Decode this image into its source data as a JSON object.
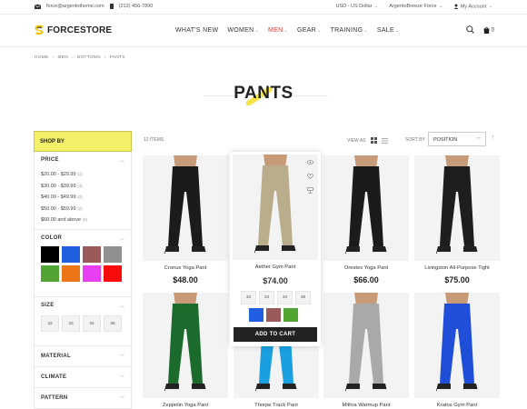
{
  "topbar": {
    "email": "force@argentotheme.com",
    "phone": "(212) 456-7890",
    "currency": "USD - US Dollar",
    "store": "ArgentoBreeze Force",
    "account": "My Account"
  },
  "header": {
    "logo": "FORCESTORE",
    "nav": [
      {
        "label": "WHAT'S NEW"
      },
      {
        "label": "WOMEN"
      },
      {
        "label": "MEN"
      },
      {
        "label": "GEAR"
      },
      {
        "label": "TRAINING"
      },
      {
        "label": "SALE"
      }
    ],
    "cart_count": "0"
  },
  "breadcrumb": [
    "HOME",
    "MEN",
    "BOTTOMS",
    "PANTS"
  ],
  "page_title": "PANTS",
  "sidebar": {
    "shop_by": "SHOP BY",
    "price": {
      "label": "PRICE",
      "items": [
        {
          "range": "$20.00 - $29.99",
          "count": "(2)"
        },
        {
          "range": "$30.00 - $39.99",
          "count": "(3)"
        },
        {
          "range": "$40.00 - $49.99",
          "count": "(2)"
        },
        {
          "range": "$50.00 - $59.99",
          "count": "(2)"
        },
        {
          "range": "$60.00 and above",
          "count": "(2)"
        }
      ]
    },
    "color": {
      "label": "COLOR",
      "swatches": [
        "#000000",
        "#1f5fe0",
        "#9b5a5a",
        "#909090",
        "#52a533",
        "#ec7615",
        "#e93ff2",
        "#fa0b0b"
      ]
    },
    "size": {
      "label": "SIZE",
      "values": [
        "32",
        "33",
        "34",
        "36"
      ]
    },
    "material": "MATERIAL",
    "climate": "CLIMATE",
    "pattern": "PATTERN"
  },
  "toolbar": {
    "items_count": "12 ITEMS",
    "view_as": "VIEW AS",
    "sort_by": "SORT BY",
    "sort_value": "POSITION"
  },
  "products": [
    {
      "name": "Cronus Yoga Pant",
      "price": "$48.00",
      "color": "#1b1b1b"
    },
    {
      "name": "Aether Gym Pant",
      "price": "$74.00",
      "color": "#b9ad8c"
    },
    {
      "name": "Orestes Yoga Pant",
      "price": "$66.00",
      "color": "#1b1b1b"
    },
    {
      "name": "Livingston All-Purpose Tight",
      "price": "$75.00",
      "color": "#1e1e1e"
    },
    {
      "name": "Zeppelin Yoga Pant",
      "price": "",
      "color": "#1b6b2c"
    },
    {
      "name": "Thorpe Track Pant",
      "price": "",
      "color": "#1a9fe0"
    },
    {
      "name": "Mithra Warmup Pant",
      "price": "",
      "color": "#a9a9a9"
    },
    {
      "name": "Kratos Gym Pant",
      "price": "",
      "color": "#1f4ed8"
    }
  ],
  "hover_card": {
    "sizes": [
      "32",
      "33",
      "34",
      "36"
    ],
    "colors": [
      "#1f5fe0",
      "#9b5a5a",
      "#52a533"
    ],
    "add_to_cart": "ADD TO CART"
  }
}
